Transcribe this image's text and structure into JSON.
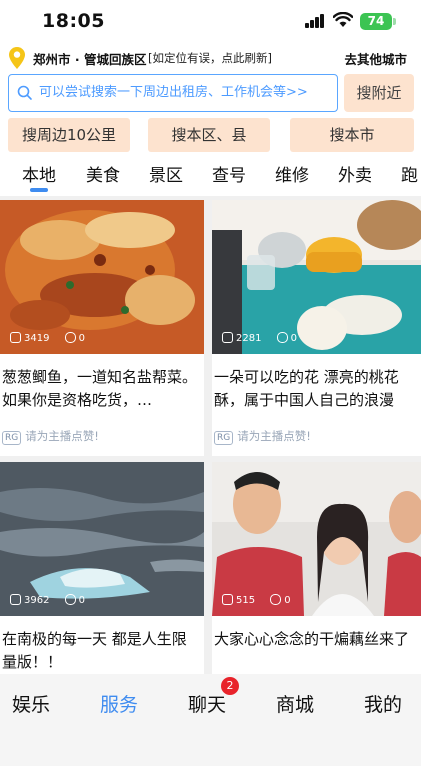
{
  "status_bar": {
    "time": "18:05",
    "battery": "74"
  },
  "location": {
    "city": "郑州市 · 管城回族区",
    "note": "[如定位有误，点此刷新]",
    "other_city": "去其他城市"
  },
  "search": {
    "placeholder": "可以尝试搜索一下周边出租房、工作机会等>>",
    "near_button": "搜附近"
  },
  "scope_buttons": [
    "搜周边10公里",
    "搜本区、县",
    "搜本市"
  ],
  "tabs": {
    "active": "本地",
    "items": [
      "本地",
      "美食",
      "景区",
      "查号",
      "维修",
      "外卖",
      "跑"
    ]
  },
  "feed": [
    {
      "title": "葱葱鲫鱼，一道知名盐帮菜。如果你是资格吃货，…",
      "views": "3419",
      "comments": "0",
      "like_tag": "RG",
      "like_text": "请为主播点赞!"
    },
    {
      "title": "一朵可以吃的花 漂亮的桃花酥，属于中国人自己的浪漫",
      "views": "2281",
      "comments": "0",
      "like_tag": "RG",
      "like_text": "请为主播点赞!"
    },
    {
      "title": "在南极的每一天 都是人生限量版！！",
      "views": "3962",
      "comments": "0",
      "like_tag": "",
      "like_text": ""
    },
    {
      "title": "大家心心念念的干煸藕丝来了",
      "views": "515",
      "comments": "0",
      "like_tag": "",
      "like_text": ""
    }
  ],
  "bottom_nav": {
    "items": [
      "娱乐",
      "服务",
      "聊天",
      "商城",
      "我的"
    ],
    "active": "服务",
    "chat_badge": "2"
  },
  "colors": {
    "accent": "#3f8cf0",
    "search_border": "#5aa6ff",
    "orange_button": "#fde3cf",
    "badge": "#e8232b",
    "battery": "#3cc453"
  }
}
